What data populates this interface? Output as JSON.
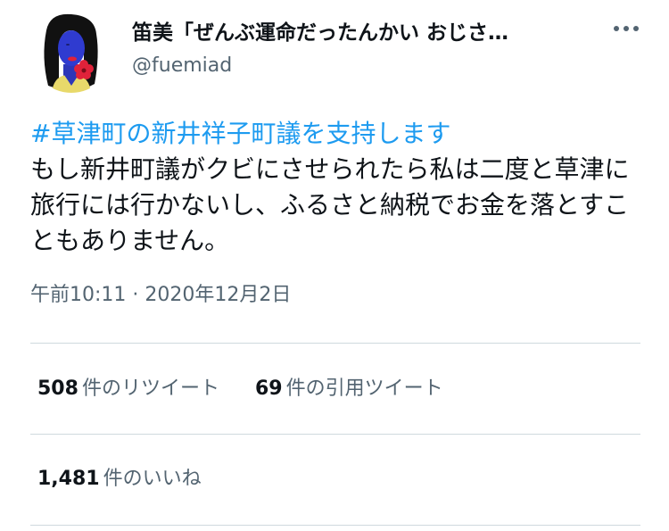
{
  "author": {
    "display_name": "笛美「ぜんぶ運命だったんかい おじさ…",
    "handle": "@fuemiad",
    "avatar_icon": "user-avatar-illustration"
  },
  "more_icon": "more-horizontal-icon",
  "tweet": {
    "hashtag": "#草津町の新井祥子町議を支持します",
    "body": "もし新井町議がクビにさせられたら私は二度と草津に旅行には行かないし、ふるさと納税でお金を落とすこともありません。"
  },
  "timestamp": "午前10:11 · 2020年12月2日",
  "stats": {
    "retweets": {
      "count": "508",
      "label": "件のリツイート"
    },
    "quotes": {
      "count": "69",
      "label": "件の引用ツイート"
    },
    "likes": {
      "count": "1,481",
      "label": "件のいいね"
    }
  },
  "colors": {
    "link": "#1d9bf0",
    "secondary_text": "#536471",
    "divider": "#cfd9de"
  }
}
